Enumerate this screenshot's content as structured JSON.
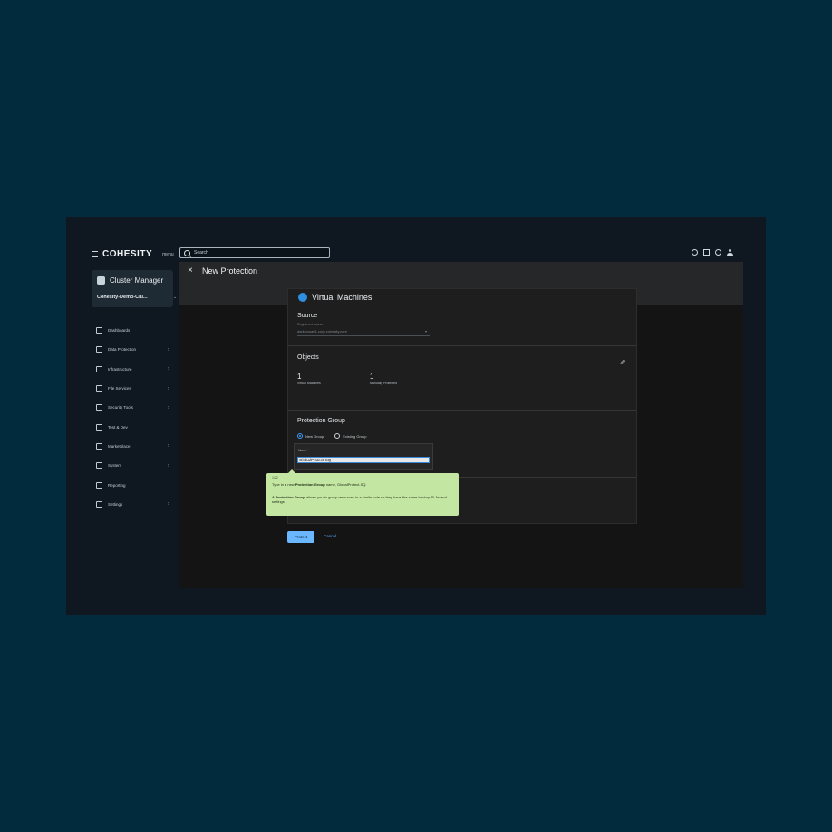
{
  "app": {
    "logo": "COHESITY",
    "menu_label": "menu",
    "search_placeholder": "Search"
  },
  "sidebar": {
    "cluster_title": "Cluster Manager",
    "cluster_name": "Cohesity-Demo-Clu...",
    "items": [
      {
        "label": "Dashboards",
        "icon": "dashboard-icon",
        "has_children": false
      },
      {
        "label": "Data Protection",
        "icon": "shield-icon",
        "has_children": true
      },
      {
        "label": "Infrastructure",
        "icon": "infrastructure-icon",
        "has_children": true
      },
      {
        "label": "File Services",
        "icon": "folder-icon",
        "has_children": true
      },
      {
        "label": "Security Tools",
        "icon": "security-icon",
        "has_children": true
      },
      {
        "label": "Test & Dev",
        "icon": "wrench-icon",
        "has_children": false
      },
      {
        "label": "Marketplace",
        "icon": "marketplace-icon",
        "has_children": true
      },
      {
        "label": "System",
        "icon": "system-icon",
        "has_children": true
      },
      {
        "label": "Reporting",
        "icon": "reporting-icon",
        "has_children": false
      },
      {
        "label": "Settings",
        "icon": "gear-icon",
        "has_children": true
      }
    ]
  },
  "page": {
    "title": "New Protection"
  },
  "panel": {
    "title": "Virtual Machines",
    "source_title": "Source",
    "source_label": "Registered source",
    "source_value": "dark-vcsa01.corp.cohesity.com",
    "objects_title": "Objects",
    "stats": [
      {
        "value": "1",
        "label": "Virtual Machines"
      },
      {
        "value": "1",
        "label": "Manually Protected"
      }
    ],
    "protection_group_title": "Protection Group",
    "radio_new": "New Group",
    "radio_existing": "Existing Group",
    "name_label": "Name *",
    "name_value": "GlobalProtect-SQ"
  },
  "actions": {
    "protect": "Protect",
    "cancel": "Cancel"
  },
  "tooltip": {
    "step": "1/22",
    "line1_prefix": "Type in a new",
    "line1_bold": "Protection Group",
    "line1_suffix": "name, GlobalProtect-SQ.",
    "line2_bold": "A Protection Group",
    "line2_text": "allows you to group resources in a similar role so they have the same backup SLAs and settings."
  },
  "colors": {
    "background": "#022b3e",
    "tooltip": "#c4e6a3",
    "accent": "#6ab7ff"
  }
}
